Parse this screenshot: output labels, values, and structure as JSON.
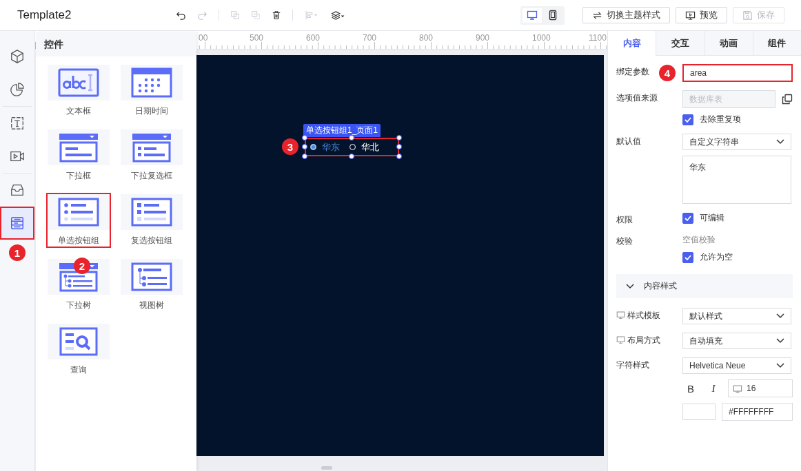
{
  "header": {
    "title": "Template2",
    "toolbar": [
      {
        "kind": "undo",
        "disabled": false
      },
      {
        "kind": "redo",
        "disabled": true
      },
      {
        "kind": "group",
        "disabled": true
      },
      {
        "kind": "ungroup",
        "disabled": true
      },
      {
        "kind": "delete",
        "disabled": false
      },
      {
        "kind": "align",
        "disabled": true
      },
      {
        "kind": "layers",
        "disabled": false
      }
    ],
    "devices": [
      {
        "kind": "desktop",
        "selected": true
      },
      {
        "kind": "mobile",
        "selected": false
      }
    ],
    "buttons": [
      {
        "kind": "theme",
        "label": "切换主题样式",
        "disabled": false
      },
      {
        "kind": "preview",
        "label": "预览",
        "disabled": false
      },
      {
        "kind": "save",
        "label": "保存",
        "disabled": true
      }
    ]
  },
  "rail": [
    {
      "kind": "cube",
      "selected": false
    },
    {
      "kind": "chart",
      "selected": false
    },
    {
      "kind": "text",
      "selected": false
    },
    {
      "kind": "video",
      "selected": false
    },
    {
      "kind": "inbox",
      "selected": false
    },
    {
      "kind": "form",
      "selected": true,
      "highlighted": true,
      "marker": "1"
    }
  ],
  "palette": {
    "title": "控件",
    "items": [
      {
        "kind": "textbox",
        "label": "文本框",
        "highlighted": false
      },
      {
        "kind": "datetime",
        "label": "日期时间",
        "highlighted": false
      },
      {
        "kind": "dropdown",
        "label": "下拉框",
        "highlighted": false
      },
      {
        "kind": "dropdown-check",
        "label": "下拉复选框",
        "highlighted": false
      },
      {
        "kind": "radio",
        "label": "单选按钮组",
        "highlighted": true,
        "marker": "2"
      },
      {
        "kind": "checkbox",
        "label": "复选按钮组",
        "highlighted": false
      },
      {
        "kind": "dropdown-tree",
        "label": "下拉树",
        "highlighted": false
      },
      {
        "kind": "tree",
        "label": "视图树",
        "highlighted": false
      },
      {
        "kind": "query",
        "label": "查询",
        "highlighted": false
      }
    ]
  },
  "ruler": {
    "labels": [
      "00",
      "500",
      "600",
      "700",
      "800",
      "900",
      "1000",
      "1100"
    ]
  },
  "canvas": {
    "widget": {
      "tag": "单选按钮组1_页面1",
      "highlighted": true,
      "marker": "3",
      "options": [
        {
          "label": "华东",
          "selected": true
        },
        {
          "label": "华北",
          "selected": false
        }
      ]
    }
  },
  "inspector": {
    "tabs": [
      {
        "label": "内容",
        "selected": true
      },
      {
        "label": "交互",
        "selected": false
      },
      {
        "label": "动画",
        "selected": false
      },
      {
        "label": "组件",
        "selected": false
      }
    ],
    "properties": [
      {
        "kind": "input",
        "label": "绑定参数",
        "value": "area",
        "highlighted": true,
        "marker": "4"
      },
      {
        "kind": "source",
        "label": "选项值来源",
        "placeholder": "数据库表",
        "checkbox": {
          "label": "去除重复项",
          "checked": true
        }
      },
      {
        "kind": "default",
        "label": "默认值",
        "select": "自定义字符串",
        "text": "华东"
      },
      {
        "kind": "check",
        "label": "权限",
        "checkbox": {
          "label": "可编辑",
          "checked": true
        }
      },
      {
        "kind": "validation",
        "label": "校验",
        "note": "空值校验",
        "checkbox": {
          "label": "允许为空",
          "checked": true
        }
      }
    ],
    "section": {
      "title": "内容样式",
      "expanded": true
    },
    "style_rows": [
      {
        "kind": "select",
        "label": "样式模板",
        "device_icon": true,
        "value": "默认样式"
      },
      {
        "kind": "select",
        "label": "布局方式",
        "device_icon": true,
        "value": "自动填充"
      },
      {
        "kind": "font",
        "label": "字符样式",
        "device_icon": false,
        "value": "Helvetica Neue",
        "bold": "B",
        "italic": "I",
        "size": "16",
        "color": "#ffffff",
        "color_text": "#FFFFFFFF"
      }
    ]
  }
}
